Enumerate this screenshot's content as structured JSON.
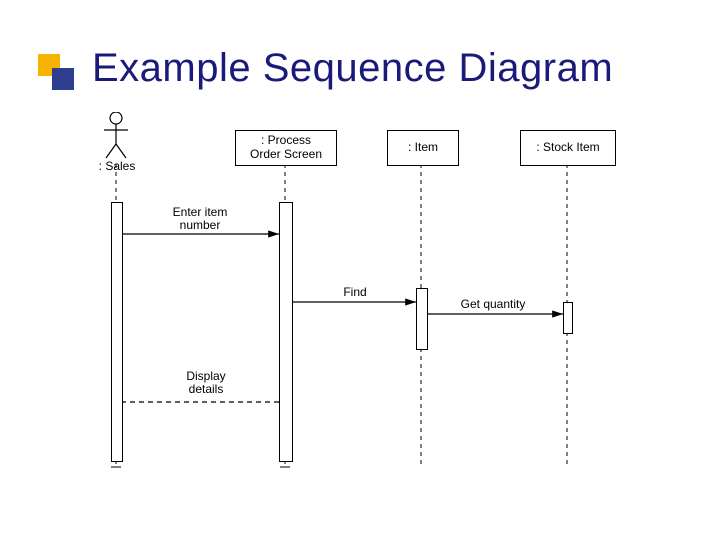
{
  "title": "Example Sequence Diagram",
  "diagram": {
    "actors": {
      "sales": {
        "label": ": Sales"
      },
      "processOrderScreen": {
        "label": ": Process\nOrder Screen"
      },
      "item": {
        "label": ": Item"
      },
      "stockItem": {
        "label": ": Stock Item"
      }
    },
    "messages": {
      "enterItemNumber": {
        "label": "Enter item\nnumber"
      },
      "find": {
        "label": "Find"
      },
      "getQuantity": {
        "label": "Get quantity"
      },
      "displayDetails": {
        "label": "Display\ndetails"
      }
    }
  }
}
